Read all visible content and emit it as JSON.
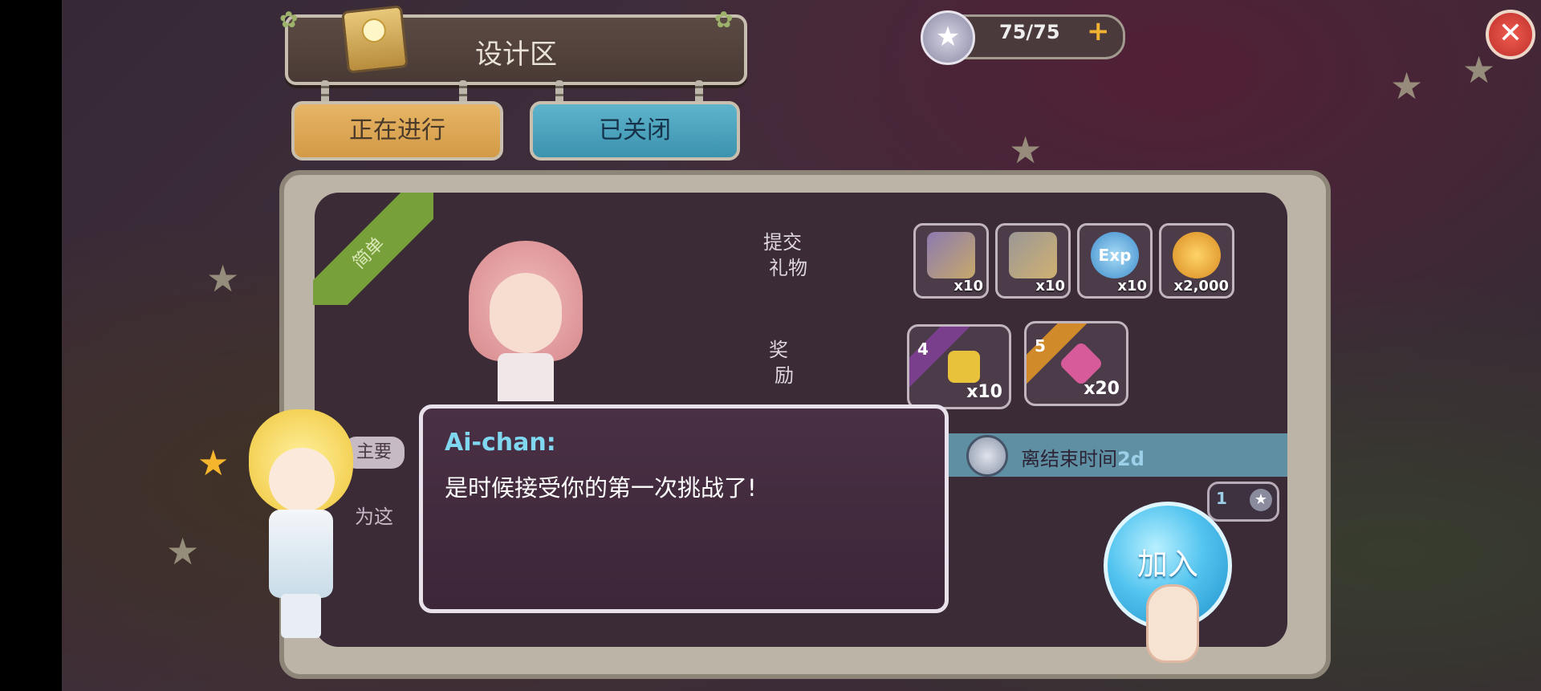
{
  "header": {
    "title": "设计区",
    "tabs": [
      {
        "label": "正在进行",
        "active": true
      },
      {
        "label": "已关闭",
        "active": false
      }
    ]
  },
  "energy": {
    "value": "75/75",
    "plus": "+",
    "icon": "star-icon"
  },
  "close": {
    "label": "✕",
    "icon": "close-icon"
  },
  "challenge": {
    "difficulty": "简单",
    "submit_label_line1": "提交",
    "submit_label_line2": "礼物",
    "reward_label_line1": "奖",
    "reward_label_line2": "励",
    "gifts": [
      {
        "icon": "mystery-clothes-icon",
        "qty": "x10"
      },
      {
        "icon": "mystery-bag-icon",
        "qty": "x10"
      },
      {
        "icon": "exp-icon",
        "qty": "x10",
        "text": "Exp"
      },
      {
        "icon": "coin-icon",
        "qty": "x2,000"
      }
    ],
    "rewards": [
      {
        "tier": "4",
        "icon": "ticket-icon",
        "qty": "x10",
        "color": "#7a3f8c"
      },
      {
        "tier": "5",
        "icon": "gem-icon",
        "qty": "x20",
        "color": "#d08a2a"
      }
    ],
    "main_tag": "主要",
    "partial_text": "为这",
    "time_label": "离结束时间",
    "time_value": "2d",
    "chip_count": "1",
    "join_label": "加入"
  },
  "dialog": {
    "speaker": "Ai-chan:",
    "text": "是时候接受你的第一次挑战了!"
  },
  "colors": {
    "accent_blue": "#53c4ef",
    "tab_active": "#e6b566",
    "tab_closed": "#5fb4cc",
    "difficulty_green": "#77a03a"
  }
}
